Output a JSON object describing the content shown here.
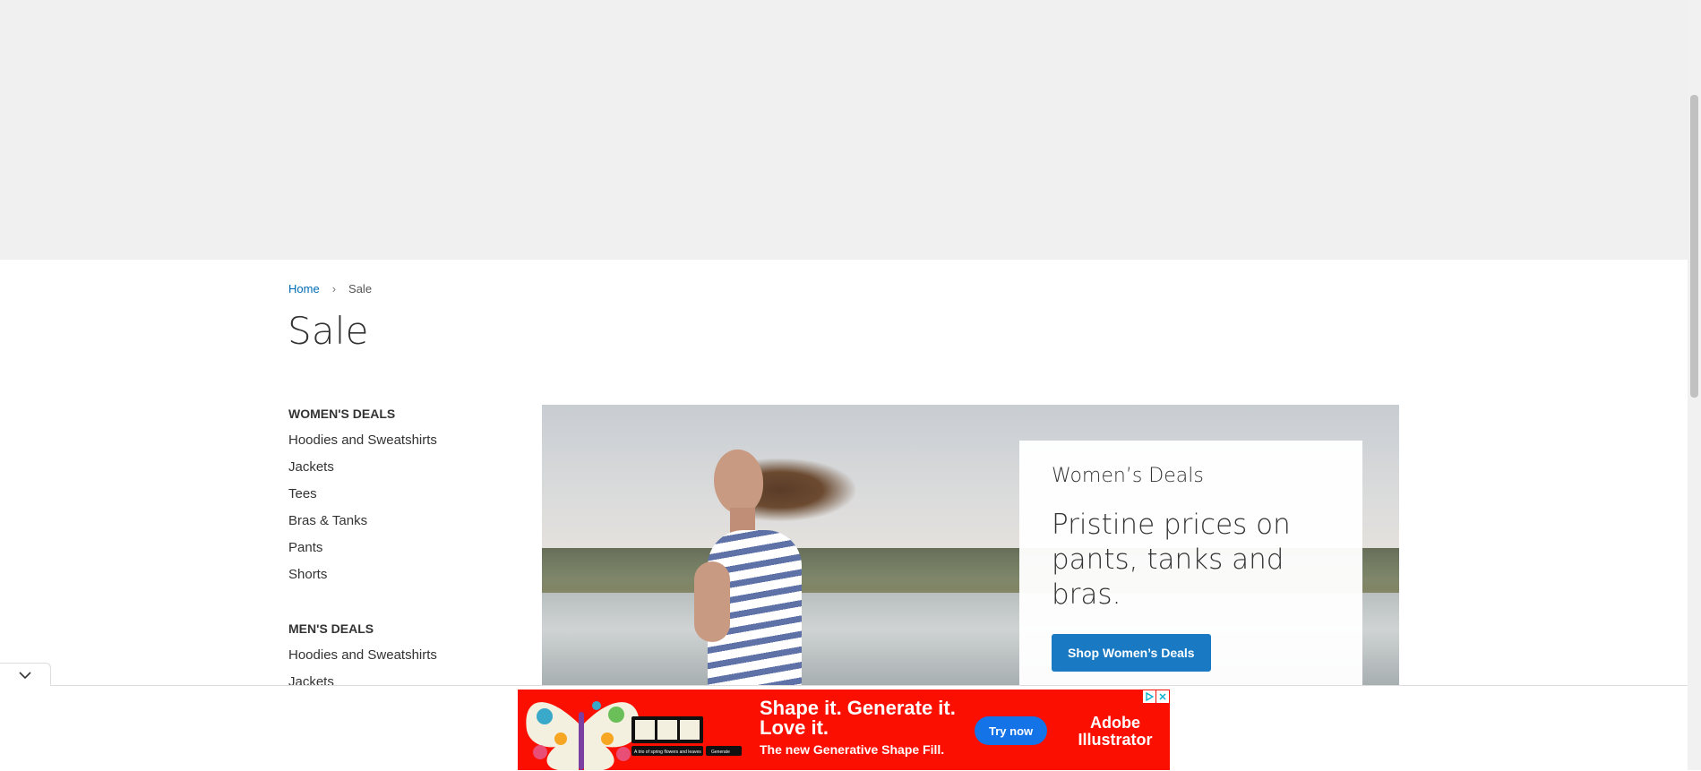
{
  "breadcrumb": {
    "home": "Home",
    "current": "Sale"
  },
  "page": {
    "title": "Sale"
  },
  "sidebar": {
    "women": {
      "heading": "WOMEN'S DEALS",
      "items": [
        "Hoodies and Sweatshirts",
        "Jackets",
        "Tees",
        "Bras & Tanks",
        "Pants",
        "Shorts"
      ]
    },
    "men": {
      "heading": "MEN'S DEALS",
      "items": [
        "Hoodies and Sweatshirts",
        "Jackets"
      ]
    }
  },
  "promo": {
    "subtitle": "Women’s Deals",
    "headline": "Pristine prices on pants, tanks and bras.",
    "button": "Shop Women’s Deals"
  },
  "ad": {
    "headline_line1": "Shape it. Generate it.",
    "headline_line2": "Love it.",
    "subline": "The new Generative Shape Fill.",
    "cta": "Try now",
    "brand_line1": "Adobe",
    "brand_line2": "Illustrator",
    "prompt_text": "A trio of spring flowers and leaves",
    "generate_label": "Generate",
    "background_color": "#fa0f00"
  },
  "colors": {
    "link": "#006bb4",
    "primary_button": "#1979c3",
    "top_band": "#f0f0f0"
  }
}
